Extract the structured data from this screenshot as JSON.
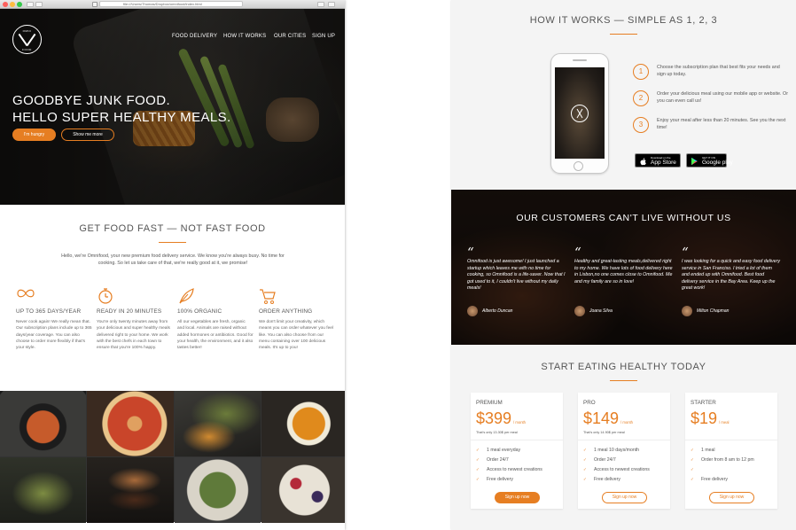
{
  "colors": {
    "accent": "#e67e22",
    "text": "#555555",
    "page_bg": "#f4f4f4"
  },
  "left_page": {
    "browser": {
      "url": "file:///Users/Thomas/Dropbox/omnifood/index.html"
    },
    "logo": {
      "text_top": "OMNI",
      "text_bottom": "FOOD"
    },
    "nav": [
      "FOOD DELIVERY",
      "HOW IT WORKS",
      "OUR CITIES",
      "SIGN UP"
    ],
    "hero": {
      "title_line1": "GOODBYE JUNK FOOD.",
      "title_line2": "HELLO SUPER HEALTHY MEALS.",
      "btn_primary": "I'm hungry",
      "btn_secondary": "Show me more"
    },
    "features_section": {
      "title": "GET FOOD FAST — NOT FAST FOOD",
      "intro": "Hello, we're Omnifood, your new premium food delivery service. We know you're always busy. No time for cooking. So let us take care of that, we're really good at it, we promise!",
      "features": [
        {
          "icon": "infinity-icon",
          "title": "UP TO 365 DAYS/YEAR",
          "text": "Never cook again! We really mean that. Our subscription plans include up to 365 days/year coverage. You can also choose to order more flexibly if that's your style."
        },
        {
          "icon": "stopwatch-icon",
          "title": "READY IN 20 MINUTES",
          "text": "You're only twenty minutes away from your delicious and super healthy meals delivered right to your home. We work with the best chefs in each town to ensure that you're 100% happy."
        },
        {
          "icon": "leaf-icon",
          "title": "100% ORGANIC",
          "text": "All our vegetables are fresh, organic and local. Animals are raised without added hormones or antibiotics. Good for your health, the environment, and it also tastes better!"
        },
        {
          "icon": "cart-icon",
          "title": "ORDER ANYTHING",
          "text": "We don't limit your creativity, which means you can order whatever you feel like. You can also choose from our menu containing over 100 delicious meals. It's up to you!"
        }
      ]
    },
    "gallery": [
      "bibimbap bowl",
      "pizza",
      "steak with fries",
      "soup",
      "salad",
      "burger",
      "greens dish",
      "berries dessert"
    ]
  },
  "right_page": {
    "how_it_works": {
      "title": "HOW IT WORKS — SIMPLE AS 1, 2, 3",
      "steps": [
        {
          "num": "1",
          "text": "Choose the subscription plan that best fits your needs and sign up today."
        },
        {
          "num": "2",
          "text": "Order your delicious meal using our mobile app or website. Or you can even call us!"
        },
        {
          "num": "3",
          "text": "Enjoy your meal after less than 20 minutes. See you the next time!"
        }
      ],
      "app_store": {
        "small": "Download on the",
        "big": "App Store"
      },
      "google_play": {
        "small": "GET IT ON",
        "big": "Google play"
      }
    },
    "testimonials": {
      "title": "OUR CUSTOMERS CAN'T LIVE WITHOUT US",
      "items": [
        {
          "quote": "Omnifood is just awesome! I just launched a startup which leaves me with no time for cooking, so Omnifood is a life-saver. Now that I got used to it, I couldn't live without my daily meals!",
          "name": "Alberto Duncan"
        },
        {
          "quote": "Healthy and great-tasting meals,delivered right to my home. We have lots of food delivery here in Lisbon,no one comes close to Omnifood. Me and my family are so in love!",
          "name": "Joana Silva"
        },
        {
          "quote": "I was looking for a quick and easy food delivery service in San Franciso. I tried a lot of them and ended up with Omnifood. Best food delivery service in the Bay Area. Keep up the great work!",
          "name": "Milton Chapman"
        }
      ]
    },
    "pricing": {
      "title": "START EATING HEALTHY TODAY",
      "plans": [
        {
          "name": "PREMIUM",
          "price": "$399",
          "per": "/ month",
          "note": "That's only 13.30$ per meal",
          "features": [
            "1 meal everyday",
            "Order 24/7",
            "Access to newest creations",
            "Free delivery"
          ],
          "button": "Sign up now",
          "button_style": "solid"
        },
        {
          "name": "PRO",
          "price": "$149",
          "per": "/ month",
          "note": "That's only 14.90$ per meal",
          "features": [
            "1 meal 10 days/month",
            "Order 24/7",
            "Access to newest creations",
            "Free delivery"
          ],
          "button": "Sign up now",
          "button_style": "ghost"
        },
        {
          "name": "STARTER",
          "price": "$19",
          "per": "/ meal",
          "note": "",
          "features": [
            "1 meal",
            "Order from 8 am to 12 pm",
            "",
            "Free delivery"
          ],
          "button": "Sign up now",
          "button_style": "ghost"
        }
      ]
    }
  }
}
